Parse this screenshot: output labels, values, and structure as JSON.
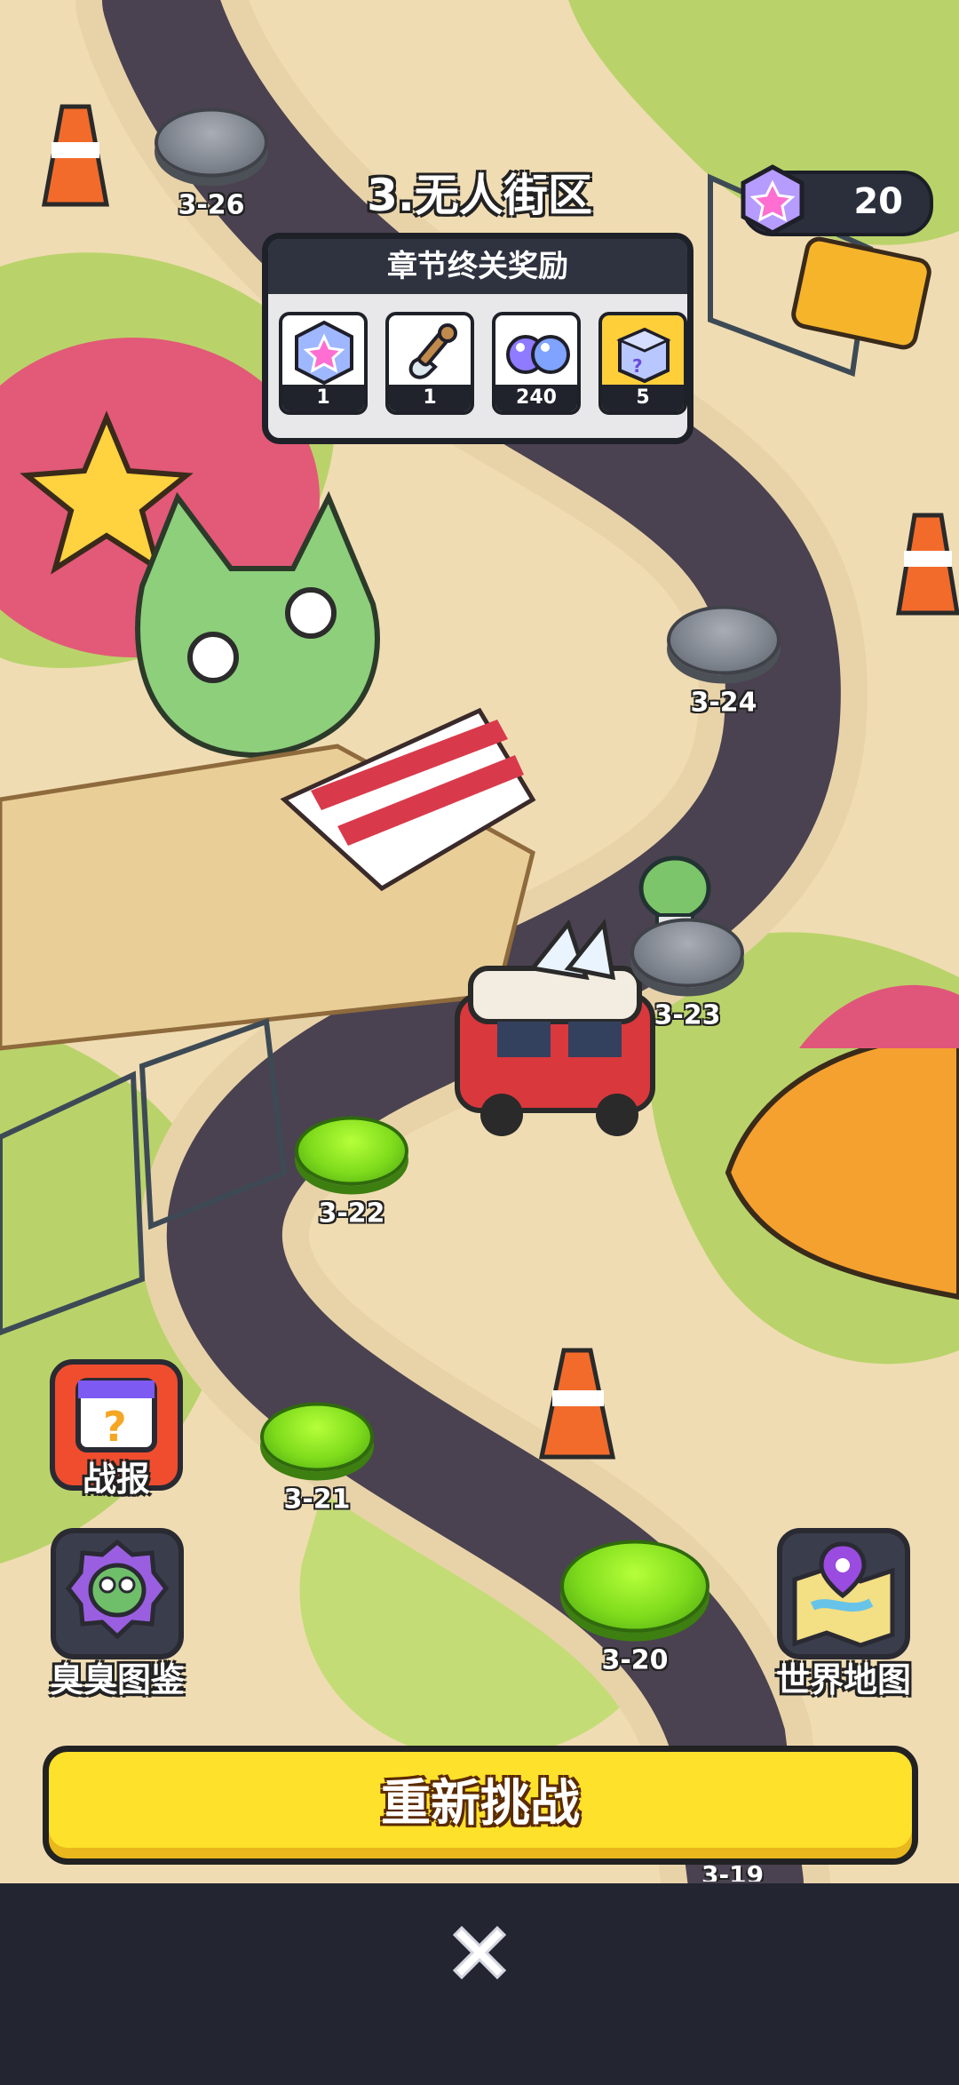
{
  "chapter_title": "3.无人街区",
  "currency": {
    "icon": "star-gem-icon",
    "value": "20"
  },
  "reward_panel": {
    "title": "章节终关奖励",
    "items": [
      {
        "icon": "star-gem-icon",
        "qty": "1"
      },
      {
        "icon": "shovel-icon",
        "qty": "1"
      },
      {
        "icon": "blue-orbs-icon",
        "qty": "240"
      },
      {
        "icon": "mystery-box-icon",
        "qty": "5"
      }
    ]
  },
  "stages": [
    {
      "label": "3-26",
      "state": "locked"
    },
    {
      "label": "3-24",
      "state": "locked"
    },
    {
      "label": "3-23",
      "state": "locked"
    },
    {
      "label": "3-22",
      "state": "cleared"
    },
    {
      "label": "3-21",
      "state": "cleared"
    },
    {
      "label": "3-20",
      "state": "cleared"
    }
  ],
  "side_buttons": {
    "battle_report": "战报",
    "zombie_guide": "臭臭图鉴",
    "world_map": "世界地图"
  },
  "retry_button": "重新挑战",
  "partial_stage_label": "3-19",
  "colors": {
    "road": "#4a4250",
    "grass": "#b9d36a",
    "button_yellow": "#fde12b",
    "dark_bar": "#232531"
  }
}
